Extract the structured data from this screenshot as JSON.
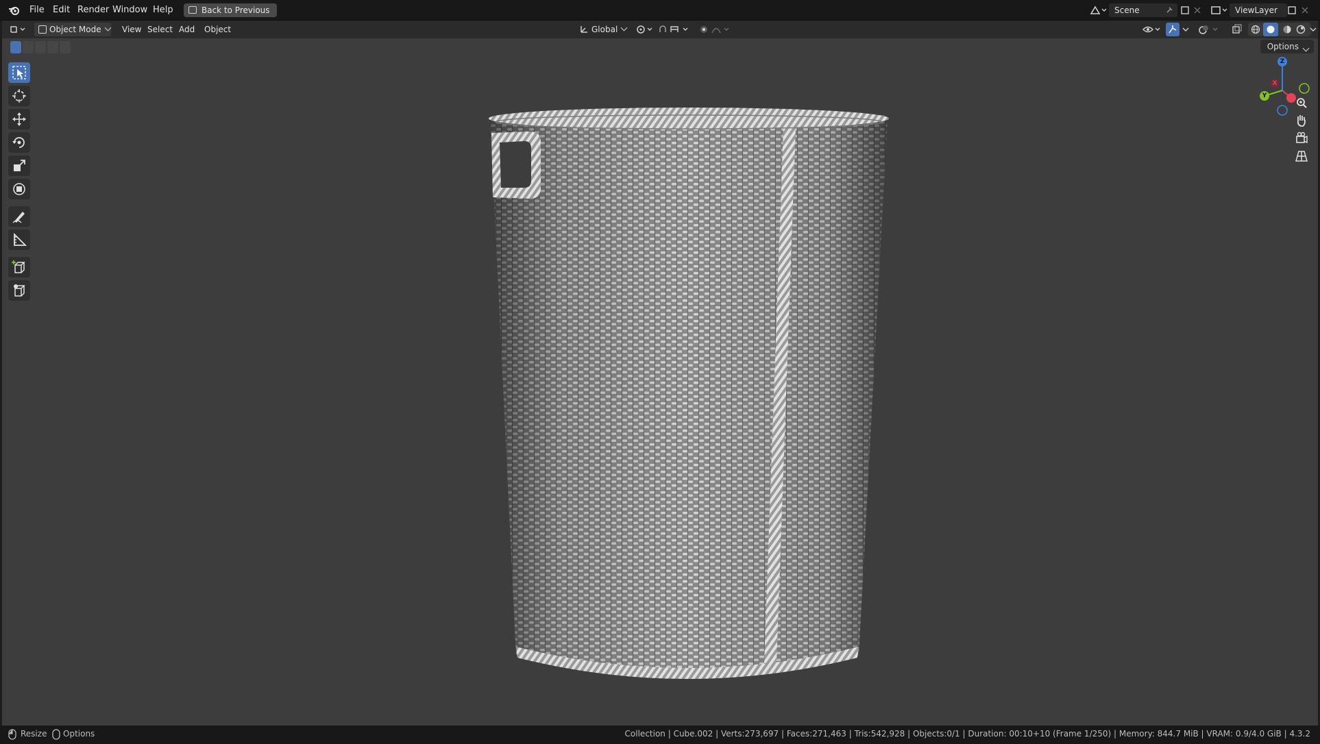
{
  "topbar": {
    "menu": [
      "File",
      "Edit",
      "Render",
      "Window",
      "Help"
    ],
    "back_button": "Back to Previous",
    "scene": "Scene",
    "view_layer": "ViewLayer"
  },
  "header": {
    "mode": "Object Mode",
    "menus": [
      "View",
      "Select",
      "Add",
      "Object"
    ],
    "orientation": "Global",
    "options": "Options"
  },
  "gizmo": {
    "z": "Z",
    "x": "X",
    "y": "Y"
  },
  "statusbar": {
    "left": [
      "Resize",
      "Options"
    ],
    "info": "Collection | Cube.002 | Verts:273,697 | Faces:271,463 | Tris:542,928 | Objects:0/1 | Duration: 00:10+10 (Frame 1/250) | Memory: 844.7 MiB | VRAM: 0.9/4.0 GiB | 4.3.2"
  },
  "colors": {
    "accent": "#4772b3",
    "viewport_bg": "#3d3d3d",
    "axis_x": "#e2425a",
    "axis_y": "#85c225",
    "axis_z": "#3b82e0"
  },
  "icons": [
    "blender-logo-icon",
    "back-icon",
    "editor-type-icon",
    "object-mode-icon",
    "transform-orientation-icon",
    "pivot-icon",
    "snap-icon",
    "proportional-icon",
    "visibility-icon",
    "gizmo-icon",
    "overlay-icon",
    "xray-icon",
    "wireframe-shading-icon",
    "solid-shading-icon",
    "material-shading-icon",
    "rendered-shading-icon",
    "select-box-icon",
    "cursor-icon",
    "move-icon",
    "rotate-icon",
    "scale-icon",
    "transform-icon",
    "annotate-icon",
    "measure-icon",
    "add-cube-icon",
    "zoom-icon",
    "pan-hand-icon",
    "camera-icon",
    "grid-icon"
  ]
}
